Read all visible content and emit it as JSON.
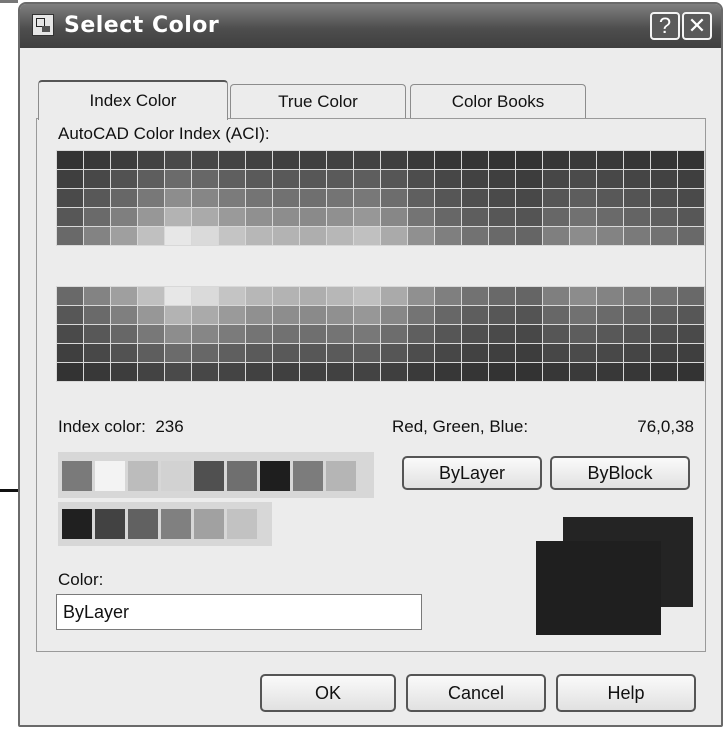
{
  "window": {
    "title": "Select Color",
    "help_glyph": "?",
    "close_glyph": "✕"
  },
  "tabs": [
    {
      "label": "Index Color",
      "active": true
    },
    {
      "label": "True Color",
      "active": false
    },
    {
      "label": "Color Books",
      "active": false
    }
  ],
  "aci": {
    "label": "AutoCAD Color Index (ACI):"
  },
  "info": {
    "index_label": "Index color:",
    "index_value": "236",
    "rgb_label": "Red, Green, Blue:",
    "rgb_value": "76,0,38"
  },
  "standard_swatches": [
    "#7a7a7a",
    "#f3f3f3",
    "#bcbcbc",
    "#d2d2d2",
    "#505050",
    "#6f6f6f",
    "#1e1e1e",
    "#7c7c7c",
    "#b5b5b5"
  ],
  "gray_swatches": [
    "#202020",
    "#424242",
    "#616161",
    "#808080",
    "#a1a1a1",
    "#c2c2c2"
  ],
  "buttons": {
    "bylayer": "ByLayer",
    "byblock": "ByBlock",
    "ok": "OK",
    "cancel": "Cancel",
    "help": "Help"
  },
  "color_field": {
    "label": "Color:",
    "value": "ByLayer"
  },
  "preview": {
    "new_color": "#1f1f1f",
    "old_color": "#242424"
  }
}
